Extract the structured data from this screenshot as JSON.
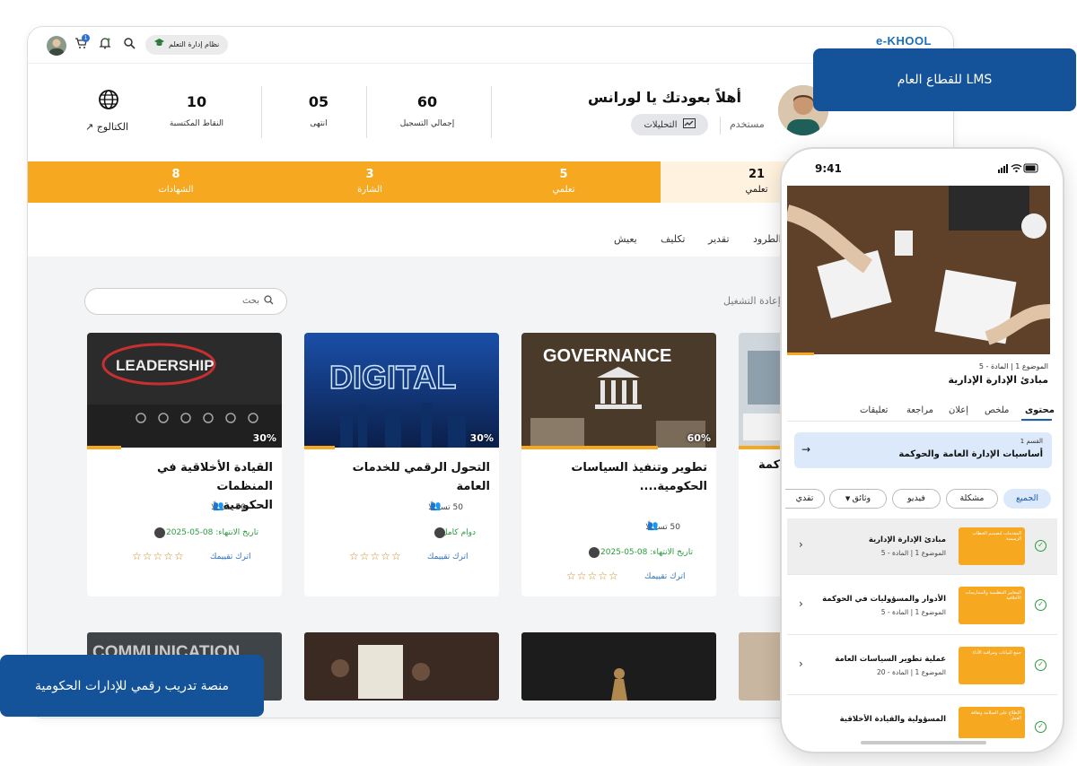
{
  "browser": {
    "logo": "e-KHOOL",
    "lms_chip": "نظام إدارة التعلم",
    "cart_count": "1"
  },
  "profile": {
    "greeting": "أهلاً بعودتك يا لورانس",
    "role": "مستخدم",
    "analytics_label": "التحليلات",
    "stats": [
      {
        "value": "60",
        "label": "إجمالي التسجيل"
      },
      {
        "value": "05",
        "label": "انتهى"
      },
      {
        "value": "10",
        "label": "النقاط المكتسبة"
      }
    ],
    "catalog_label": "الكتالوج"
  },
  "progress_tabs": [
    {
      "value": "21",
      "label": "تعلمي",
      "active": true
    },
    {
      "value": "5",
      "label": "تعلمي",
      "active": false
    },
    {
      "value": "3",
      "label": "الشارة",
      "active": false
    },
    {
      "value": "8",
      "label": "الشهادات",
      "active": false
    }
  ],
  "filters": [
    "الطرود",
    "تقدير",
    "تكليف",
    "يعيش"
  ],
  "search": {
    "placeholder": "بحث",
    "replay": "إعادة التشغيل"
  },
  "cards": [
    {
      "title_line1": "القيادة الأخلاقية في المنظمات",
      "title_line2": "الحكومية",
      "image_text": "LEADERSHIP",
      "percent_label": "30%",
      "progress": 0.18,
      "enrolled": "50 تسجيلًا",
      "status": "تاريخ الانتهاء: 08-05-2025",
      "rate": "اترك تقييمك",
      "stars": "☆☆☆☆☆"
    },
    {
      "title_line1": "التحول الرقمي للخدمات العامة",
      "title_line2": "",
      "image_text": "DIGITAL",
      "percent_label": "30%",
      "progress": 0.16,
      "enrolled": "50 تسجيلًا",
      "status": "دوام كامل",
      "rate": "اترك تقييمك",
      "stars": "☆☆☆☆☆"
    },
    {
      "title_line1": "تطوير وتنفيذ السياسات",
      "title_line2": "الحكومية....",
      "image_text": "GOVERNANCE",
      "percent_label": "60%",
      "progress": 0.7,
      "enrolled": "50 تسجيلًا",
      "status": "تاريخ الانتهاء: 08-05-2025",
      "rate": "اترك تقييمك",
      "stars": "☆☆☆☆☆"
    },
    {
      "title_line1": "كمة",
      "title_line2": ""
    }
  ],
  "bottom_thumb_text": "COMMUNICATION",
  "overlays": {
    "top_right": "للقطاع العام LMS",
    "bottom_left": "منصة تدريب رقمي للإدارات الحكومية"
  },
  "phone": {
    "time": "9:41",
    "lesson_meta": "الموضوع 1 | المادة - 5",
    "lesson_title": "مبادئ الإدارة الإدارية",
    "tabs": [
      "محتوى",
      "ملخص",
      "إعلان",
      "مراجعة",
      "تعليقات"
    ],
    "section_label": "القسم 1",
    "section_title": "أساسيات الإدارة العامة والحوكمة",
    "chips": [
      "الجميع",
      "مشكلة",
      "فيديو",
      "وثائق",
      "تقدي"
    ],
    "rows": [
      {
        "title": "مبادئ الإدارة الإدارية",
        "meta": "الموضوع 1 | المادة - 5",
        "thumb": "المقدمات لتصميم الخطاب الرسمية"
      },
      {
        "title": "الأدوار والمسؤوليات في الحوكمة",
        "meta": "الموضوع 1 | المادة - 5",
        "thumb": "المعايير التنظيمية والممارسات الأخلاقية"
      },
      {
        "title": "عملية تطوير السياسات العامة",
        "meta": "الموضوع 1 | المادة - 20",
        "thumb": "جمع البيانات ومراقبة الأداء"
      },
      {
        "title": "المسؤولية والقيادة الأخلاقية",
        "meta": "",
        "thumb": "الإطلاع على السلامة وثقافة العمل"
      }
    ]
  },
  "colors": {
    "accent": "#f6a821",
    "brand": "#14539a",
    "success": "#2a9b3e",
    "link": "#2f72c4"
  }
}
